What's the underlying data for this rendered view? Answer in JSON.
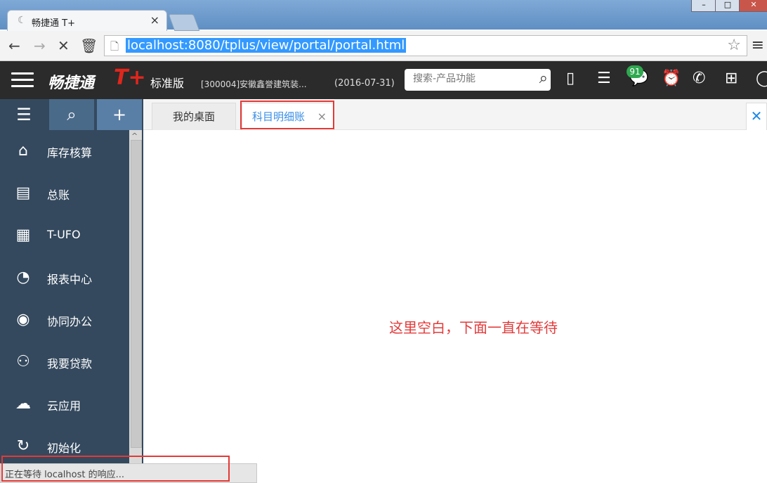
{
  "browser": {
    "tab_title": "畅捷通 T+",
    "tab_close": "×",
    "url": "localhost:8080/tplus/view/portal/portal.html",
    "win_controls": [
      "–",
      "□",
      "✕"
    ]
  },
  "app": {
    "brand": "畅捷通",
    "brand_t": "T+",
    "edition": "标准版",
    "company": "[300004]安徽鑫誉建筑装...",
    "date": "(2016-07-31)",
    "search_placeholder": "搜索-产品功能",
    "notification_count": "91"
  },
  "sidebar": {
    "items": [
      {
        "label": "库存核算",
        "icon": "warehouse-icon"
      },
      {
        "label": "总账",
        "icon": "ledger-icon"
      },
      {
        "label": "T-UFO",
        "icon": "ufo-report-icon"
      },
      {
        "label": "报表中心",
        "icon": "pie-chart-icon"
      },
      {
        "label": "协同办公",
        "icon": "collaboration-icon"
      },
      {
        "label": "我要贷款",
        "icon": "loan-icon"
      },
      {
        "label": "云应用",
        "icon": "cloud-icon"
      },
      {
        "label": "初始化",
        "icon": "refresh-icon"
      }
    ]
  },
  "tabs": [
    {
      "label": "我的桌面",
      "active": false
    },
    {
      "label": "科目明细账",
      "active": true,
      "close": "×"
    }
  ],
  "close_all": "✕",
  "annotation": "这里空白，下面一直在等待",
  "status": "正在等待 localhost 的响应...",
  "colors": {
    "accent": "#3399ff",
    "brand_red": "#e1261c",
    "sidebar_bg": "#34495e",
    "annotation_red": "#e53935"
  }
}
